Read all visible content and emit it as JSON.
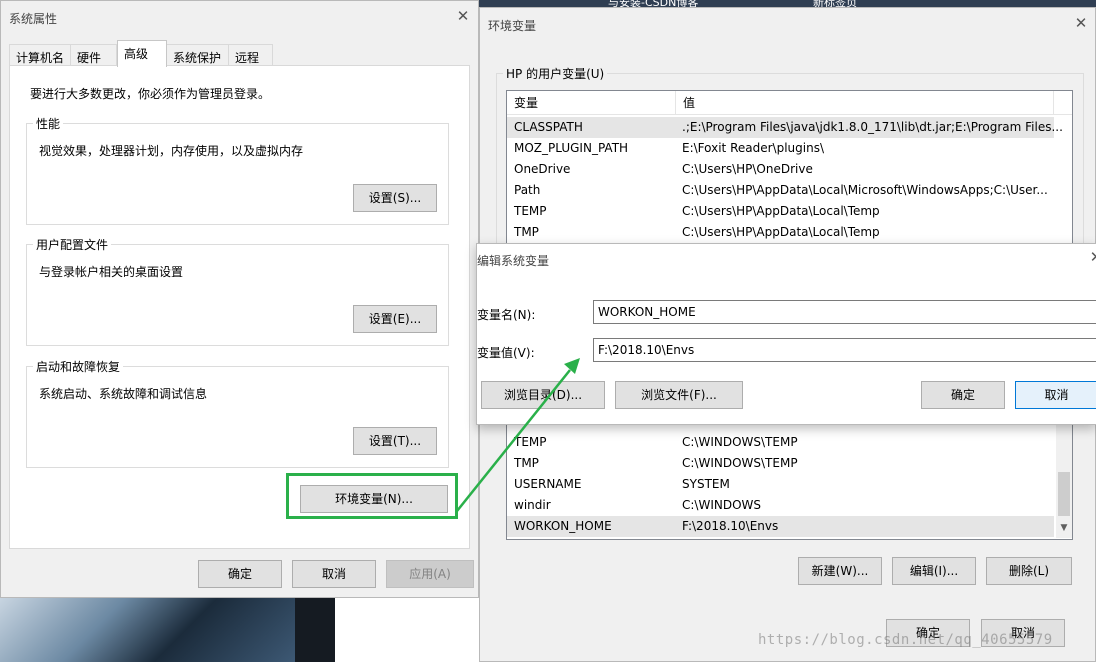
{
  "taskbar": {
    "tab1": "与安装-CSDN博客",
    "tab2": "新标签页"
  },
  "sysprops": {
    "title": "系统属性",
    "tabs": [
      "计算机名",
      "硬件",
      "高级",
      "系统保护",
      "远程"
    ],
    "admin_note": "要进行大多数更改，你必须作为管理员登录。",
    "performance": {
      "title": "性能",
      "desc": "视觉效果，处理器计划，内存使用，以及虚拟内存",
      "button": "设置(S)..."
    },
    "profiles": {
      "title": "用户配置文件",
      "desc": "与登录帐户相关的桌面设置",
      "button": "设置(E)..."
    },
    "startup": {
      "title": "启动和故障恢复",
      "desc": "系统启动、系统故障和调试信息",
      "button": "设置(T)..."
    },
    "env_button": "环境变量(N)...",
    "ok": "确定",
    "cancel": "取消",
    "apply": "应用(A)"
  },
  "envvars": {
    "title": "环境变量",
    "user_group": "HP 的用户变量(U)",
    "col_var": "变量",
    "col_val": "值",
    "user_rows": [
      {
        "name": "CLASSPATH",
        "value": ".;E:\\Program Files\\java\\jdk1.8.0_171\\lib\\dt.jar;E:\\Program Files..."
      },
      {
        "name": "MOZ_PLUGIN_PATH",
        "value": "E:\\Foxit Reader\\plugins\\"
      },
      {
        "name": "OneDrive",
        "value": "C:\\Users\\HP\\OneDrive"
      },
      {
        "name": "Path",
        "value": "C:\\Users\\HP\\AppData\\Local\\Microsoft\\WindowsApps;C:\\User..."
      },
      {
        "name": "TEMP",
        "value": "C:\\Users\\HP\\AppData\\Local\\Temp"
      },
      {
        "name": "TMP",
        "value": "C:\\Users\\HP\\AppData\\Local\\Temp"
      }
    ],
    "system_rows": [
      {
        "name": "TEMP",
        "value": "C:\\WINDOWS\\TEMP"
      },
      {
        "name": "TMP",
        "value": "C:\\WINDOWS\\TEMP"
      },
      {
        "name": "USERNAME",
        "value": "SYSTEM"
      },
      {
        "name": "windir",
        "value": "C:\\WINDOWS"
      },
      {
        "name": "WORKON_HOME",
        "value": "F:\\2018.10\\Envs"
      }
    ],
    "new": "新建(W)...",
    "edit": "编辑(I)...",
    "delete": "删除(L)",
    "ok": "确定",
    "cancel": "取消"
  },
  "editsys": {
    "title": "编辑系统变量",
    "name_label": "变量名(N):",
    "name_value": "WORKON_HOME",
    "value_label": "变量值(V):",
    "value_value": "F:\\2018.10\\Envs",
    "browse_dir": "浏览目录(D)...",
    "browse_file": "浏览文件(F)...",
    "ok": "确定",
    "cancel": "取消"
  },
  "watermark": "https://blog.csdn.net/qq_40655579",
  "colors": {
    "highlight": "#2ab04a",
    "accent": "#0078d7"
  }
}
